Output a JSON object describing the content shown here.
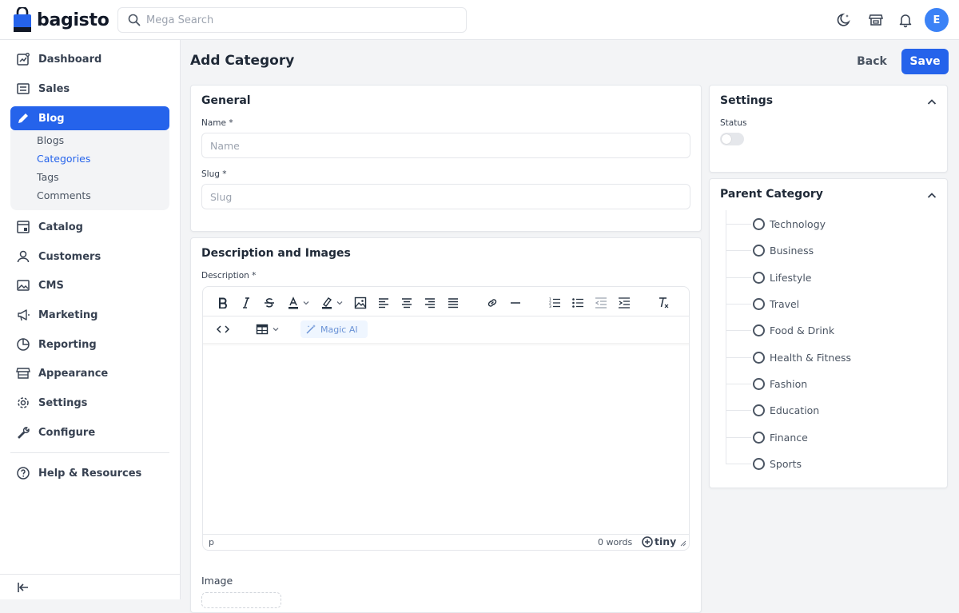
{
  "header": {
    "logo_text": "bagisto",
    "search_placeholder": "Mega Search",
    "avatar_initial": "E",
    "accent_color": "#2563eb"
  },
  "sidebar": {
    "items": [
      {
        "label": "Dashboard",
        "icon": "dashboard-icon"
      },
      {
        "label": "Sales",
        "icon": "sales-icon"
      },
      {
        "label": "Blog",
        "icon": "pencil-icon",
        "active": true
      },
      {
        "label": "Catalog",
        "icon": "catalog-icon"
      },
      {
        "label": "Customers",
        "icon": "user-icon"
      },
      {
        "label": "CMS",
        "icon": "image-icon"
      },
      {
        "label": "Marketing",
        "icon": "megaphone-icon"
      },
      {
        "label": "Reporting",
        "icon": "pie-chart-icon"
      },
      {
        "label": "Appearance",
        "icon": "store-icon"
      },
      {
        "label": "Settings",
        "icon": "gear-icon"
      },
      {
        "label": "Configure",
        "icon": "wrench-icon"
      },
      {
        "label": "Help & Resources",
        "icon": "help-icon"
      }
    ],
    "blog_subitems": [
      "Blogs",
      "Categories",
      "Tags",
      "Comments"
    ],
    "active_subitem": "Categories"
  },
  "page": {
    "title": "Add Category",
    "back_label": "Back",
    "save_label": "Save"
  },
  "general": {
    "title": "General",
    "name_label": "Name *",
    "name_placeholder": "Name",
    "slug_label": "Slug *",
    "slug_placeholder": "Slug"
  },
  "description": {
    "title": "Description and Images",
    "description_label": "Description *",
    "magic_ai_label": "Magic AI",
    "statusbar_path": "p",
    "word_count": "0 words",
    "brand": "tiny",
    "image_label": "Image"
  },
  "settings": {
    "title": "Settings",
    "status_label": "Status",
    "status_enabled": false
  },
  "parent_category": {
    "title": "Parent Category",
    "options": [
      "Technology",
      "Business",
      "Lifestyle",
      "Travel",
      "Food & Drink",
      "Health & Fitness",
      "Fashion",
      "Education",
      "Finance",
      "Sports"
    ]
  }
}
